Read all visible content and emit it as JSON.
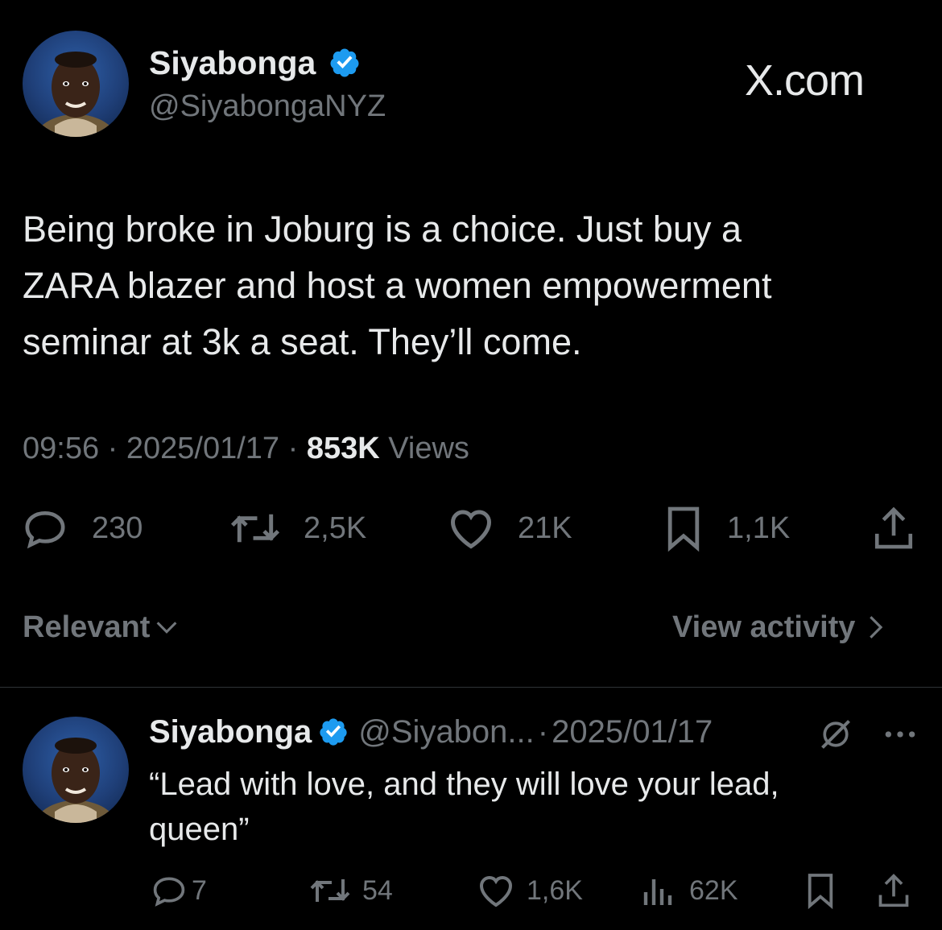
{
  "brand": {
    "watermark": "X.com"
  },
  "tweet": {
    "author_name": "Siyabonga",
    "author_handle": "@SiyabongaNYZ",
    "text_lines": [
      "Being broke in Joburg is a choice. Just buy a",
      "ZARA blazer and host a women empowerment",
      "seminar at 3k a seat. They’ll come."
    ],
    "time": "09:56",
    "date": "2025/01/17",
    "views_count": "853K",
    "views_label": "Views",
    "sep": "·",
    "replies": "230",
    "reposts": "2,5K",
    "likes": "21K",
    "bookmarks": "1,1K"
  },
  "controls": {
    "sort_label": "Relevant",
    "activity_label": "View activity"
  },
  "reply": {
    "author_name": "Siyabonga",
    "author_handle": "@Siyabon...",
    "sep": "·",
    "date": "2025/01/17",
    "text_lines": [
      "“Lead with love, and they will love your lead,",
      "queen”"
    ],
    "replies": "7",
    "reposts": "54",
    "likes": "1,6K",
    "views": "62K"
  },
  "colors": {
    "background": "#000000",
    "text": "#e7e9ea",
    "muted": "#71767b",
    "verified": "#1d9bf0",
    "divider": "#2f3336"
  },
  "icons": [
    "verified-badge-icon",
    "reply-icon",
    "repost-icon",
    "like-icon",
    "bookmark-icon",
    "share-icon",
    "chevron-down-icon",
    "chevron-right-icon",
    "grok-icon",
    "more-icon",
    "views-icon"
  ]
}
